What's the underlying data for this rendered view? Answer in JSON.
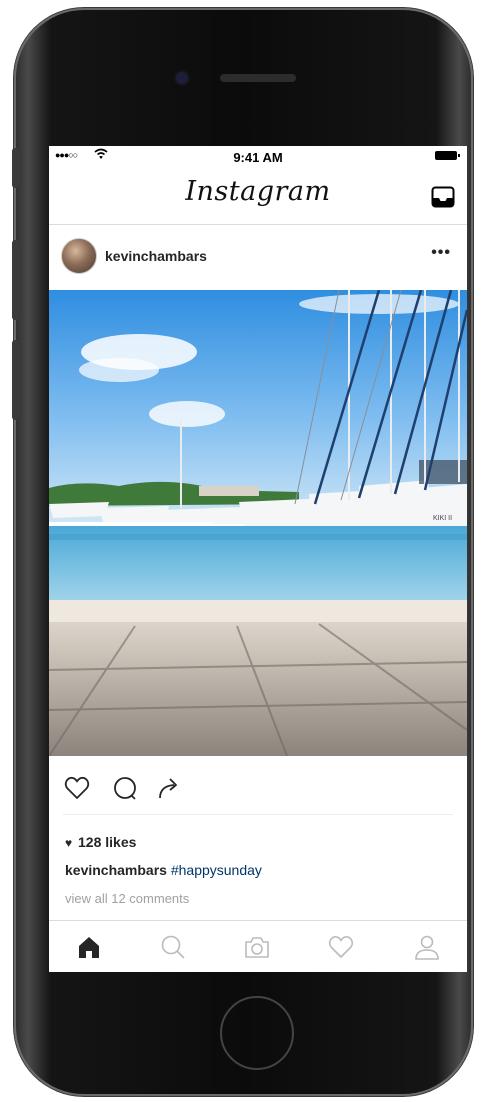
{
  "status_bar": {
    "signal": "●●●○○",
    "time": "9:41 AM"
  },
  "header": {
    "logo_text": "Instagram"
  },
  "post": {
    "username": "kevinchambars",
    "likes_count": "128 likes",
    "caption_user": "kevinchambars",
    "caption_hashtag": "#happysunday",
    "comments_link": "view all 12 comments",
    "boat_name": "KIKI II"
  },
  "icons": {
    "wifi": "wifi-icon",
    "battery": "battery-icon",
    "inbox": "inbox-icon",
    "more": "more-icon",
    "like": "heart-outline-icon",
    "comment": "comment-bubble-icon",
    "share": "share-arrow-icon",
    "tab_home": "home-icon",
    "tab_search": "search-icon",
    "tab_camera": "camera-icon",
    "tab_activity": "heart-outline-icon",
    "tab_profile": "profile-icon"
  },
  "colors": {
    "hashtag": "#003569",
    "muted_text": "#a0a0a0",
    "divider": "#dbdbdb"
  }
}
